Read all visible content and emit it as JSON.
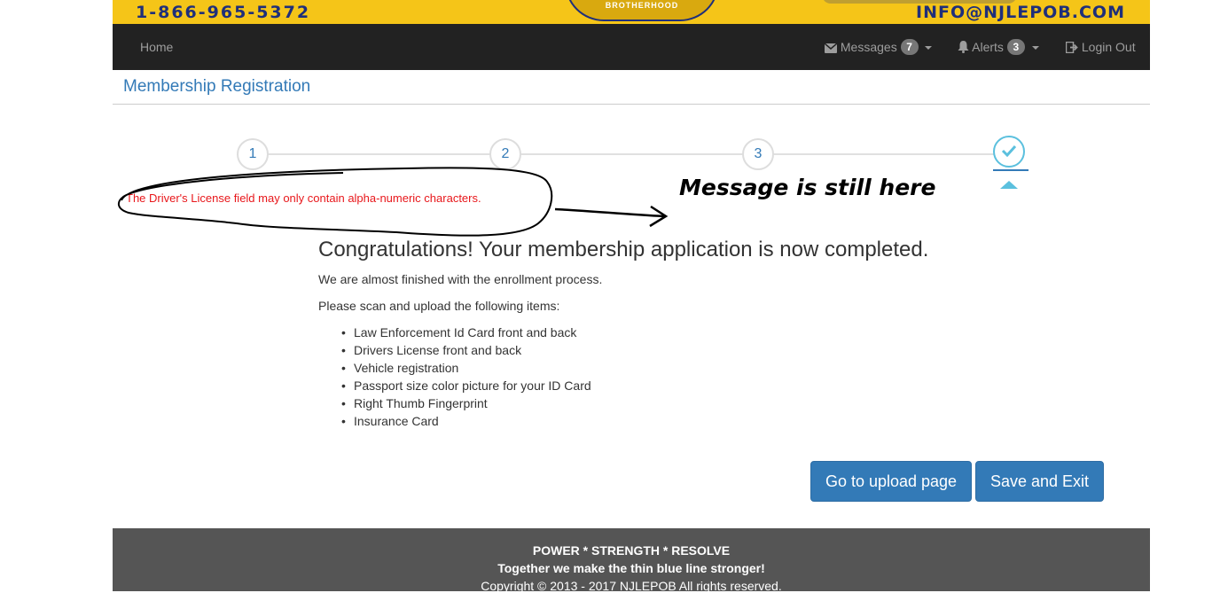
{
  "banner": {
    "phone": "1-866-965-5372",
    "logo_text": "BROTHERHOOD",
    "email": "INFO@NJLEPOB.COM"
  },
  "navbar": {
    "home": "Home",
    "messages_label": "Messages",
    "messages_count": "7",
    "alerts_label": "Alerts",
    "alerts_count": "3",
    "login_out": "Login Out"
  },
  "page": {
    "title": "Membership Registration"
  },
  "steps": [
    "1",
    "2",
    "3"
  ],
  "error_message": "The Driver's License field may only contain alpha-numeric characters.",
  "annotation": "Message is still here",
  "content": {
    "heading": "Congratulations! Your membership application is now completed.",
    "para1": "We are almost finished with the enrollment process.",
    "para2": "Please scan and upload the following items:",
    "items": [
      "Law Enforcement Id Card front and back",
      "Drivers License front and back",
      "Vehicle registration",
      "Passport size color picture for your ID Card",
      "Right Thumb Fingerprint",
      "Insurance Card"
    ]
  },
  "buttons": {
    "upload": "Go to upload page",
    "save_exit": "Save and Exit"
  },
  "footer": {
    "line1": "POWER * STRENGTH * RESOLVE",
    "line2": "Together we make the thin blue line stronger!",
    "line3": "Copyright © 2013 - 2017 NJLEPOB   All rights reserved."
  },
  "colors": {
    "banner_yellow": "#f5c518",
    "navbar_bg": "#222222",
    "link_blue": "#337ab7",
    "step_done": "#5bc0de",
    "error_red": "#e8171b",
    "footer_bg": "#555555"
  }
}
